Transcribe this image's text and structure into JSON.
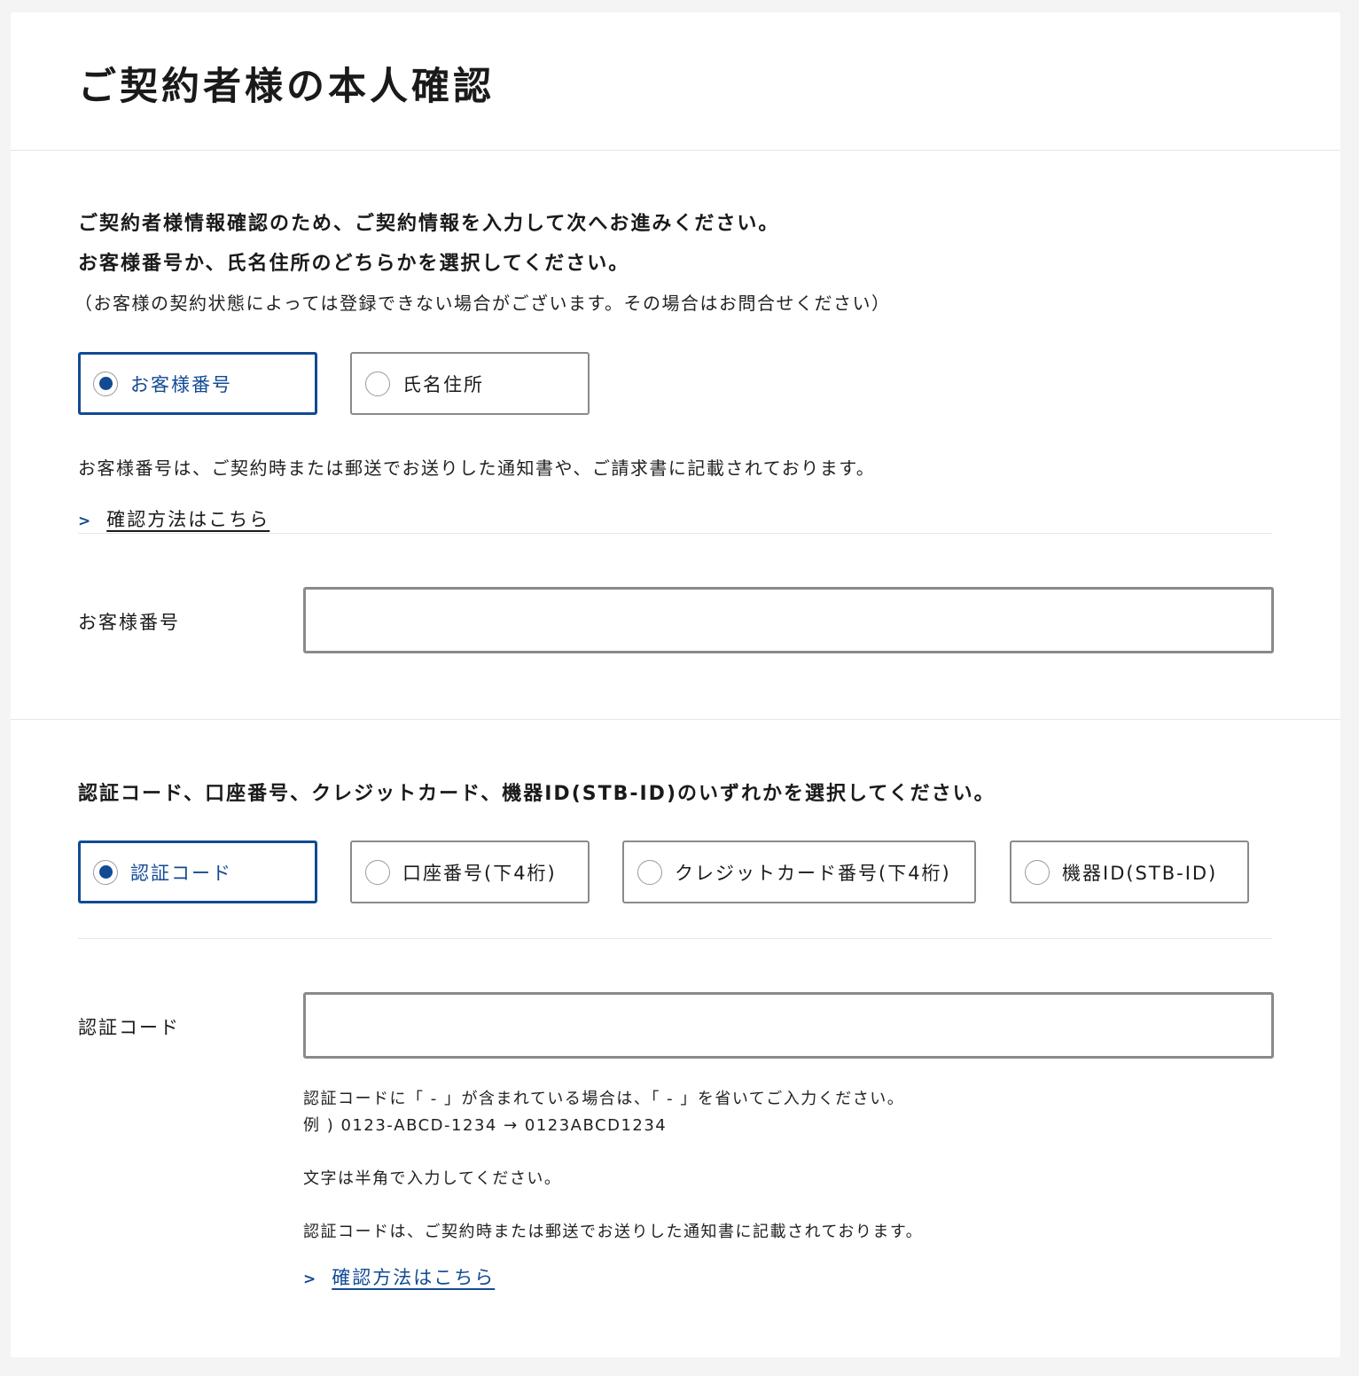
{
  "page": {
    "title": "ご契約者様の本人確認"
  },
  "section1": {
    "lead_line1": "ご契約者様情報確認のため、ご契約情報を入力して次へお進みください。",
    "lead_line2": "お客様番号か、氏名住所のどちらかを選択してください。",
    "note": "（お客様の契約状態によっては登録できない場合がございます。その場合はお問合せください）",
    "options": [
      {
        "label": "お客様番号",
        "selected": true
      },
      {
        "label": "氏名住所",
        "selected": false
      }
    ],
    "help_text": "お客様番号は、ご契約時または郵送でお送りした通知書や、ご請求書に記載されております。",
    "link_chevron": ">",
    "link_label": "確認方法はこちら",
    "field_label": "お客様番号",
    "field_value": "",
    "field_placeholder": ""
  },
  "section2": {
    "lead": "認証コード、口座番号、クレジットカード、機器ID(STB-ID)のいずれかを選択してください。",
    "options": [
      {
        "label": "認証コード",
        "selected": true
      },
      {
        "label": "口座番号(下4桁)",
        "selected": false
      },
      {
        "label": "クレジットカード番号(下4桁)",
        "selected": false
      },
      {
        "label": "機器ID(STB-ID)",
        "selected": false
      }
    ],
    "field_label": "認証コード",
    "field_value": "",
    "field_placeholder": "",
    "hint_line1": "認証コードに「 - 」が含まれている場合は、「 - 」を省いてご入力ください。",
    "hint_line2": "例 ) 0123-ABCD-1234 → 0123ABCD1234",
    "hint_line3": "文字は半角で入力してください。",
    "hint_line4": "認証コードは、ご契約時または郵送でお送りした通知書に記載されております。",
    "link_chevron": ">",
    "link_label": "確認方法はこちら"
  },
  "colors": {
    "accent": "#124a94",
    "border": "#8a8a8a",
    "background": "#f4f4f4",
    "card": "#ffffff"
  }
}
